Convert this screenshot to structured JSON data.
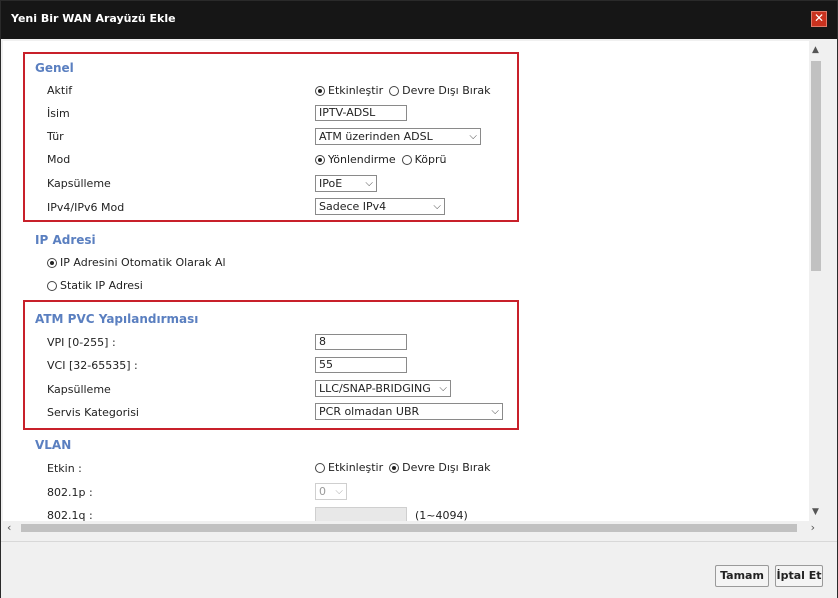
{
  "window": {
    "title": "Yeni Bir WAN Arayüzü Ekle",
    "close_glyph": "✕"
  },
  "genel": {
    "title": "Genel",
    "aktif": {
      "label": "Aktif",
      "options": [
        "Etkinleştir",
        "Devre Dışı Bırak"
      ],
      "selected": "Etkinleştir"
    },
    "isim": {
      "label": "İsim",
      "value": "IPTV-ADSL"
    },
    "tur": {
      "label": "Tür",
      "value": "ATM üzerinden ADSL"
    },
    "mod": {
      "label": "Mod",
      "options": [
        "Yönlendirme",
        "Köprü"
      ],
      "selected": "Yönlendirme"
    },
    "kapsulleme": {
      "label": "Kapsülleme",
      "value": "IPoE"
    },
    "ipmod": {
      "label": "IPv4/IPv6 Mod",
      "value": "Sadece IPv4"
    }
  },
  "ip_adresi": {
    "title": "IP Adresi",
    "options": [
      "IP Adresini Otomatik Olarak Al",
      "Statik IP Adresi"
    ],
    "selected": "IP Adresini Otomatik Olarak Al"
  },
  "atm": {
    "title": "ATM PVC Yapılandırması",
    "vpi": {
      "label": "VPI [0-255] :",
      "value": "8"
    },
    "vci": {
      "label": "VCI [32-65535] :",
      "value": "55"
    },
    "kapsulleme": {
      "label": "Kapsülleme",
      "value": "LLC/SNAP-BRIDGING"
    },
    "servis": {
      "label": "Servis Kategorisi",
      "value": "PCR olmadan UBR"
    }
  },
  "vlan": {
    "title": "VLAN",
    "etkin": {
      "label": "Etkin :",
      "options": [
        "Etkinleştir",
        "Devre Dışı Bırak"
      ],
      "selected": "Devre Dışı Bırak"
    },
    "p8021": {
      "label": "802.1p :",
      "value": "0"
    },
    "q8021": {
      "label": "802.1q :",
      "value": "",
      "hint": "(1~4094)"
    }
  },
  "footer": {
    "ok_label": "Tamam",
    "cancel_label": "İptal Et"
  },
  "colors": {
    "section_title": "#5a7fc0",
    "highlight_box": "#c8202a",
    "titlebar": "#161616"
  }
}
